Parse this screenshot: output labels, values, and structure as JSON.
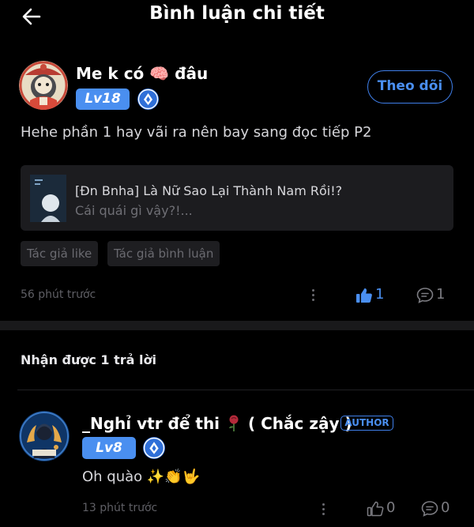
{
  "header": {
    "title": "Bình luận chi tiết"
  },
  "comment": {
    "username_before": "Me k có",
    "username_emoji": "🧠",
    "username_after": "đâu",
    "level": "Lv18",
    "follow_label": "Theo dõi",
    "text": "Hehe phần 1 hay vãi ra nên bay sang đọc tiếp P2",
    "book": {
      "title": "[Đn Bnha] Là Nữ Sao Lại Thành Nam Rồi!?",
      "subtitle": "Cái quái gì vậy?!..."
    },
    "tags": [
      "Tác giả like",
      "Tác giả bình luận"
    ],
    "time": "56 phút trước",
    "like_count": "1",
    "reply_count": "1"
  },
  "replies": {
    "heading": "Nhận được 1 trả lời",
    "items": [
      {
        "username": "_Nghỉ vtr để thi",
        "username_suffix": "( Chắc zậy )",
        "author_badge": "AUTHOR",
        "level": "Lv8",
        "text": "Oh quào",
        "emojis": "✨👏🤟",
        "time": "13 phút trước",
        "like_count": "0",
        "reply_count": "0"
      }
    ]
  },
  "colors": {
    "accent": "#4a8ff0",
    "background": "#000000",
    "card": "#1c1c1f",
    "liked": "#4a8ff0"
  },
  "icons": [
    "back-arrow-icon",
    "brain-emoji",
    "verified-icon",
    "thumbs-up-icon",
    "comment-icon",
    "more-icon",
    "rose-icon"
  ]
}
